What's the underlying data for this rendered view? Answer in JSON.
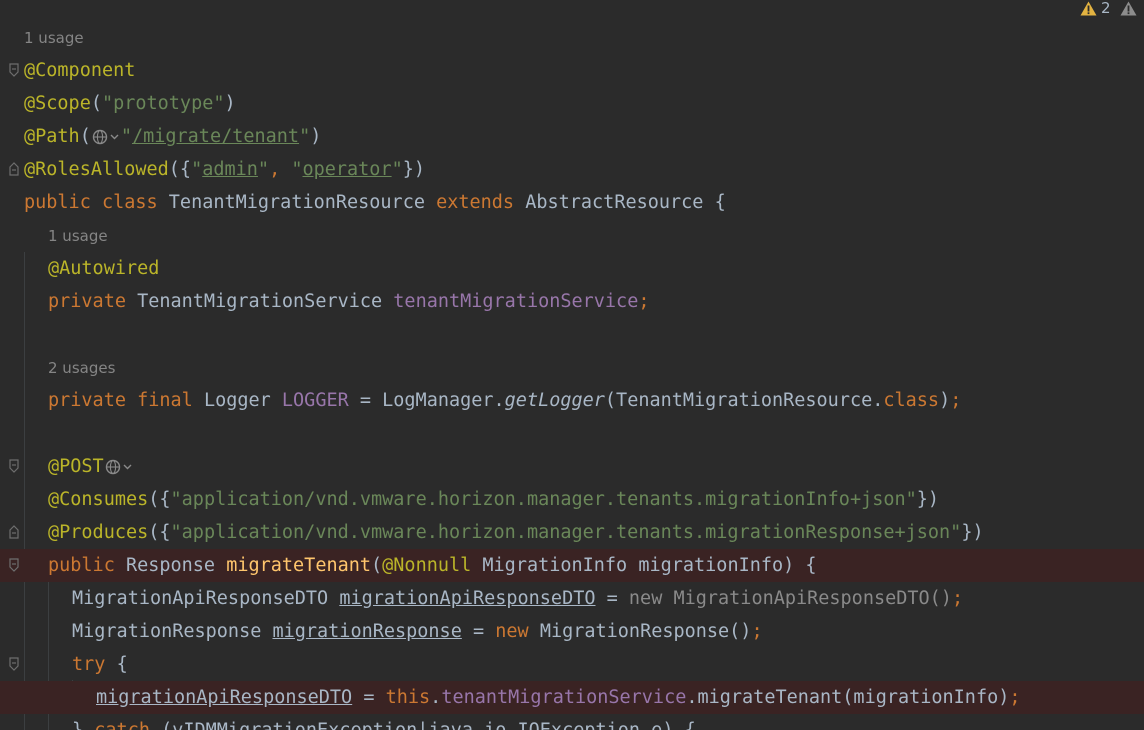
{
  "warnings": {
    "count": "2"
  },
  "lines": {
    "l0_usage": "1 usage",
    "l1": "@Component",
    "l2_a": "@Scope",
    "l2_b": "(",
    "l2_c": "\"prototype\"",
    "l2_d": ")",
    "l3_a": "@Path",
    "l3_b": "(",
    "l3_c": "\"",
    "l3_d": "/migrate/tenant",
    "l3_e": "\"",
    "l3_f": ")",
    "l4_a": "@RolesAllowed",
    "l4_b": "({",
    "l4_c": "\"",
    "l4_d": "admin",
    "l4_e": "\"",
    "l4_f": ", ",
    "l4_g": "\"",
    "l4_h": "operator",
    "l4_i": "\"",
    "l4_j": "})",
    "l5_a": "public class ",
    "l5_b": "TenantMigrationResource ",
    "l5_c": "extends ",
    "l5_d": "AbstractResource {",
    "l6_usage": "1 usage",
    "l7": "@Autowired",
    "l8_a": "private ",
    "l8_b": "TenantMigrationService ",
    "l8_c": "tenantMigrationService",
    "l8_d": ";",
    "l9_usage": "2 usages",
    "l10_a": "private final ",
    "l10_b": "Logger ",
    "l10_c": "LOGGER",
    "l10_d": " = LogManager.",
    "l10_e": "getLogger",
    "l10_f": "(TenantMigrationResource.",
    "l10_g": "class",
    "l10_h": ")",
    "l10_i": ";",
    "l11": "@POST",
    "l12_a": "@Consumes",
    "l12_b": "({",
    "l12_c": "\"application/vnd.vmware.horizon.manager.tenants.migrationInfo+json\"",
    "l12_d": "})",
    "l13_a": "@Produces",
    "l13_b": "({",
    "l13_c": "\"application/vnd.vmware.horizon.manager.tenants.migrationResponse+json\"",
    "l13_d": "})",
    "l14_a": "public ",
    "l14_b": "Response ",
    "l14_c": "migrateTenant",
    "l14_d": "(",
    "l14_e": "@Nonnull ",
    "l14_f": "MigrationInfo migrationInfo) {",
    "l15_a": "MigrationApiResponseDTO ",
    "l15_b": "migrationApiResponseDTO",
    "l15_c": " = ",
    "l15_d": "new MigrationApiResponseDTO()",
    "l15_e": ";",
    "l16_a": "MigrationResponse ",
    "l16_b": "migrationResponse",
    "l16_c": " = ",
    "l16_d": "new ",
    "l16_e": "MigrationResponse()",
    "l16_f": ";",
    "l17_a": "try ",
    "l17_b": "{",
    "l18_a": "migrationApiResponseDTO",
    "l18_b": " = ",
    "l18_c": "this",
    "l18_d": ".",
    "l18_e": "tenantMigrationService",
    "l18_f": ".migrateTenant(migrationInfo)",
    "l18_g": ";",
    "l19_a": "} ",
    "l19_b": "catch ",
    "l19_c": "(vIDMMigrationException|java.io.IOException e) {"
  },
  "colors": {
    "background": "#2b2b2b",
    "keyword": "#cc7832",
    "annotation": "#bbb529",
    "string": "#6a8759",
    "field": "#9876aa",
    "method": "#ffc66d",
    "text": "#a9b7c6",
    "breakpoint_line": "#3a2323",
    "warning": "#e3b341"
  },
  "icons": [
    "warning-icon",
    "globe-icon",
    "fold-icon"
  ]
}
